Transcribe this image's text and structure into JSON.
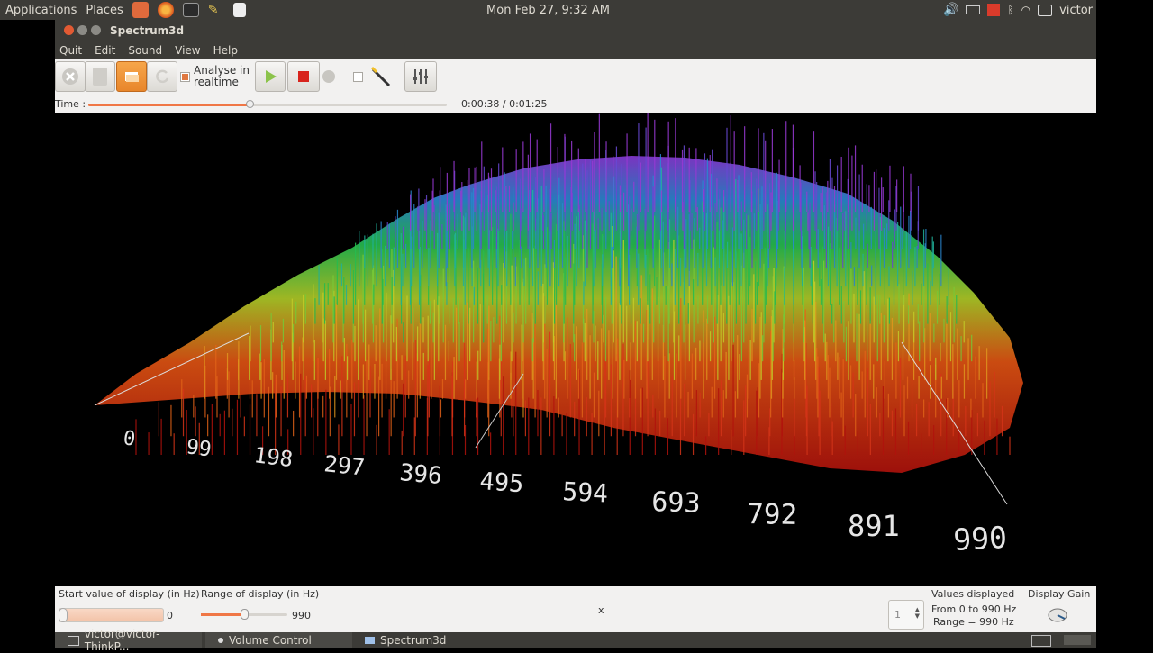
{
  "system_bar": {
    "menus": [
      "Applications",
      "Places"
    ],
    "datetime": "Mon Feb 27,  9:32 AM",
    "user": "victor"
  },
  "window": {
    "title": "Spectrum3d",
    "menu": [
      "Quit",
      "Edit",
      "Sound",
      "View",
      "Help"
    ]
  },
  "toolbar": {
    "analyse_label_line1": "Analyse in",
    "analyse_label_line2": "realtime",
    "analyse_checked": true,
    "misc_checked": false
  },
  "time": {
    "label": "Time :",
    "readout": "0:00:38 / 0:01:25",
    "progress": 0.45
  },
  "spectrum": {
    "axis_labels": [
      "0",
      "99",
      "198",
      "297",
      "396",
      "495",
      "594",
      "693",
      "792",
      "891",
      "990"
    ]
  },
  "controls": {
    "start_label": "Start value of display (in Hz)",
    "start_value": "0",
    "range_label": "Range of display (in Hz)",
    "range_value": "990",
    "range_slider_position": 0.5,
    "center_text": "x",
    "spin_value": "1",
    "values_displayed_label": "Values displayed",
    "values_from": "From 0 to 990 Hz",
    "values_range": "Range = 990 Hz",
    "gain_label": "Display Gain"
  },
  "taskbar": {
    "items": [
      "victor@victor-ThinkP...",
      "Volume Control",
      "Spectrum3d"
    ]
  },
  "colors": {
    "panel": "#3c3b37",
    "toolbar_bg": "#f2f1f0",
    "accent_orange": "#f07746",
    "close_button": "#e25a33"
  }
}
